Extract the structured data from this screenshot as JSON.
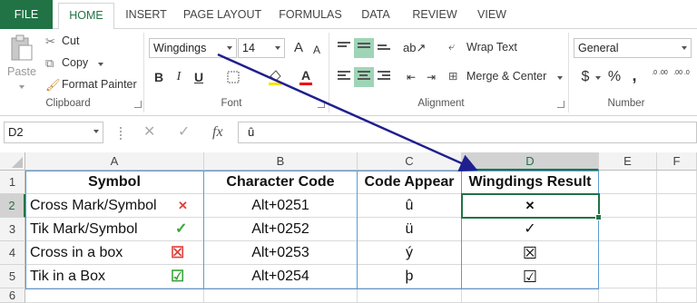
{
  "tabs": [
    "FILE",
    "HOME",
    "INSERT",
    "PAGE LAYOUT",
    "FORMULAS",
    "DATA",
    "REVIEW",
    "VIEW"
  ],
  "ribbon": {
    "clipboard": {
      "paste": "Paste",
      "cut": "Cut",
      "copy": "Copy",
      "format_painter": "Format Painter",
      "label": "Clipboard"
    },
    "font": {
      "name": "Wingdings",
      "size": "14",
      "grow": "A",
      "shrink": "A",
      "bold": "B",
      "italic": "I",
      "underline": "U",
      "font_color": "A",
      "label": "Font"
    },
    "alignment": {
      "wrap_text": "Wrap Text",
      "merge_center": "Merge & Center",
      "label": "Alignment"
    },
    "number": {
      "format": "General",
      "currency": "$",
      "percent": "%",
      "comma": ",",
      "inc_decimal": ".0 .00",
      "dec_decimal": ".00 .0",
      "label": "Number"
    }
  },
  "formula_bar": {
    "name_box": "D2",
    "cancel": "✕",
    "enter": "✓",
    "fx": "fx",
    "value": "û"
  },
  "columns": [
    "A",
    "B",
    "C",
    "D",
    "E",
    "F"
  ],
  "rows": [
    "1",
    "2",
    "3",
    "4",
    "5",
    "6"
  ],
  "table": {
    "headers": [
      "Symbol",
      "Character Code",
      "Code Appear",
      "Wingdings Result"
    ],
    "rows": [
      {
        "symbol": "Cross Mark/Symbol",
        "code": "Alt+0251",
        "appear": "û",
        "result": "✕",
        "icon": "✕",
        "icon_color": "#e0403a"
      },
      {
        "symbol": "Tik Mark/Symbol",
        "code": "Alt+0252",
        "appear": "ü",
        "result": "✓",
        "icon": "✓",
        "icon_color": "#3aa63a"
      },
      {
        "symbol": "Cross in a box",
        "code": "Alt+0253",
        "appear": "ý",
        "result": "☒",
        "icon": "☒",
        "icon_color": "#e0403a"
      },
      {
        "symbol": "Tik in a Box",
        "code": "Alt+0254",
        "appear": "þ",
        "result": "☑",
        "icon": "☑",
        "icon_color": "#3aa63a"
      }
    ]
  },
  "colors": {
    "accent": "#217346",
    "table_border": "#5b9bd5",
    "arrow": "#1f1f8f",
    "highlight": "#9fd5b7"
  }
}
